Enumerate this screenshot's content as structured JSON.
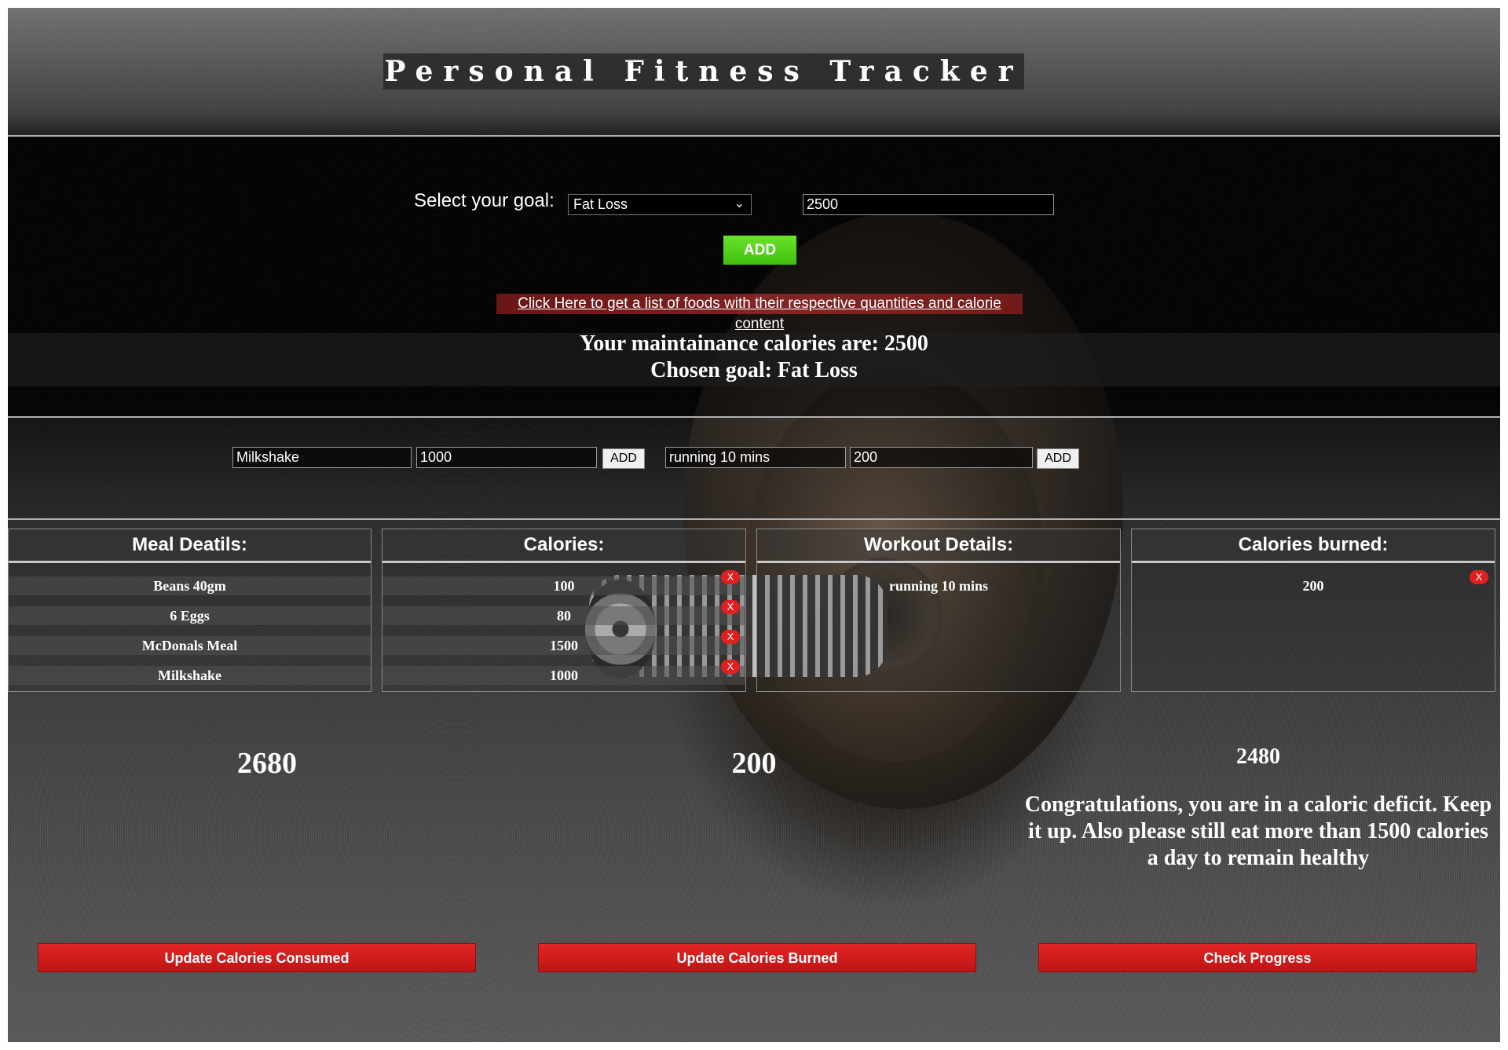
{
  "header": {
    "title": "Personal Fitness Tracker"
  },
  "goal": {
    "label": "Select your goal:",
    "selected": "Fat Loss",
    "maintenance_input": "2500",
    "add_label": "ADD",
    "food_link": "Click Here to get a list of foods with their respective quantities and calorie content",
    "maintenance_text": "Your maintainance calories are: 2500",
    "chosen_text": "Chosen goal: Fat Loss"
  },
  "entry": {
    "meal_name": "Milkshake",
    "meal_calories": "1000",
    "meal_add": "ADD",
    "workout_name": "running 10 mins",
    "workout_calories": "200",
    "workout_add": "ADD"
  },
  "columns": {
    "meal_header": "Meal Deatils:",
    "calories_header": "Calories:",
    "workout_header": "Workout Details:",
    "burned_header": "Calories burned:",
    "delete_label": "X"
  },
  "meals": [
    {
      "name": "Beans 40gm",
      "calories": "100"
    },
    {
      "name": "6 Eggs",
      "calories": "80"
    },
    {
      "name": "McDonals Meal",
      "calories": "1500"
    },
    {
      "name": "Milkshake",
      "calories": "1000"
    }
  ],
  "workouts": [
    {
      "name": "running 10 mins",
      "calories": "200"
    }
  ],
  "totals": {
    "consumed": "2680",
    "burned": "200",
    "net": "2480"
  },
  "progress_message": "Congratulations, you are in a caloric deficit. Keep it up. Also please still eat more than 1500 calories a day to remain healthy",
  "buttons": {
    "update_consumed": "Update Calories Consumed",
    "update_burned": "Update Calories Burned",
    "check_progress": "Check Progress"
  },
  "colors": {
    "accent_green": "#4fd11b",
    "button_red": "#d01c1c",
    "delete_red": "#e02020"
  }
}
